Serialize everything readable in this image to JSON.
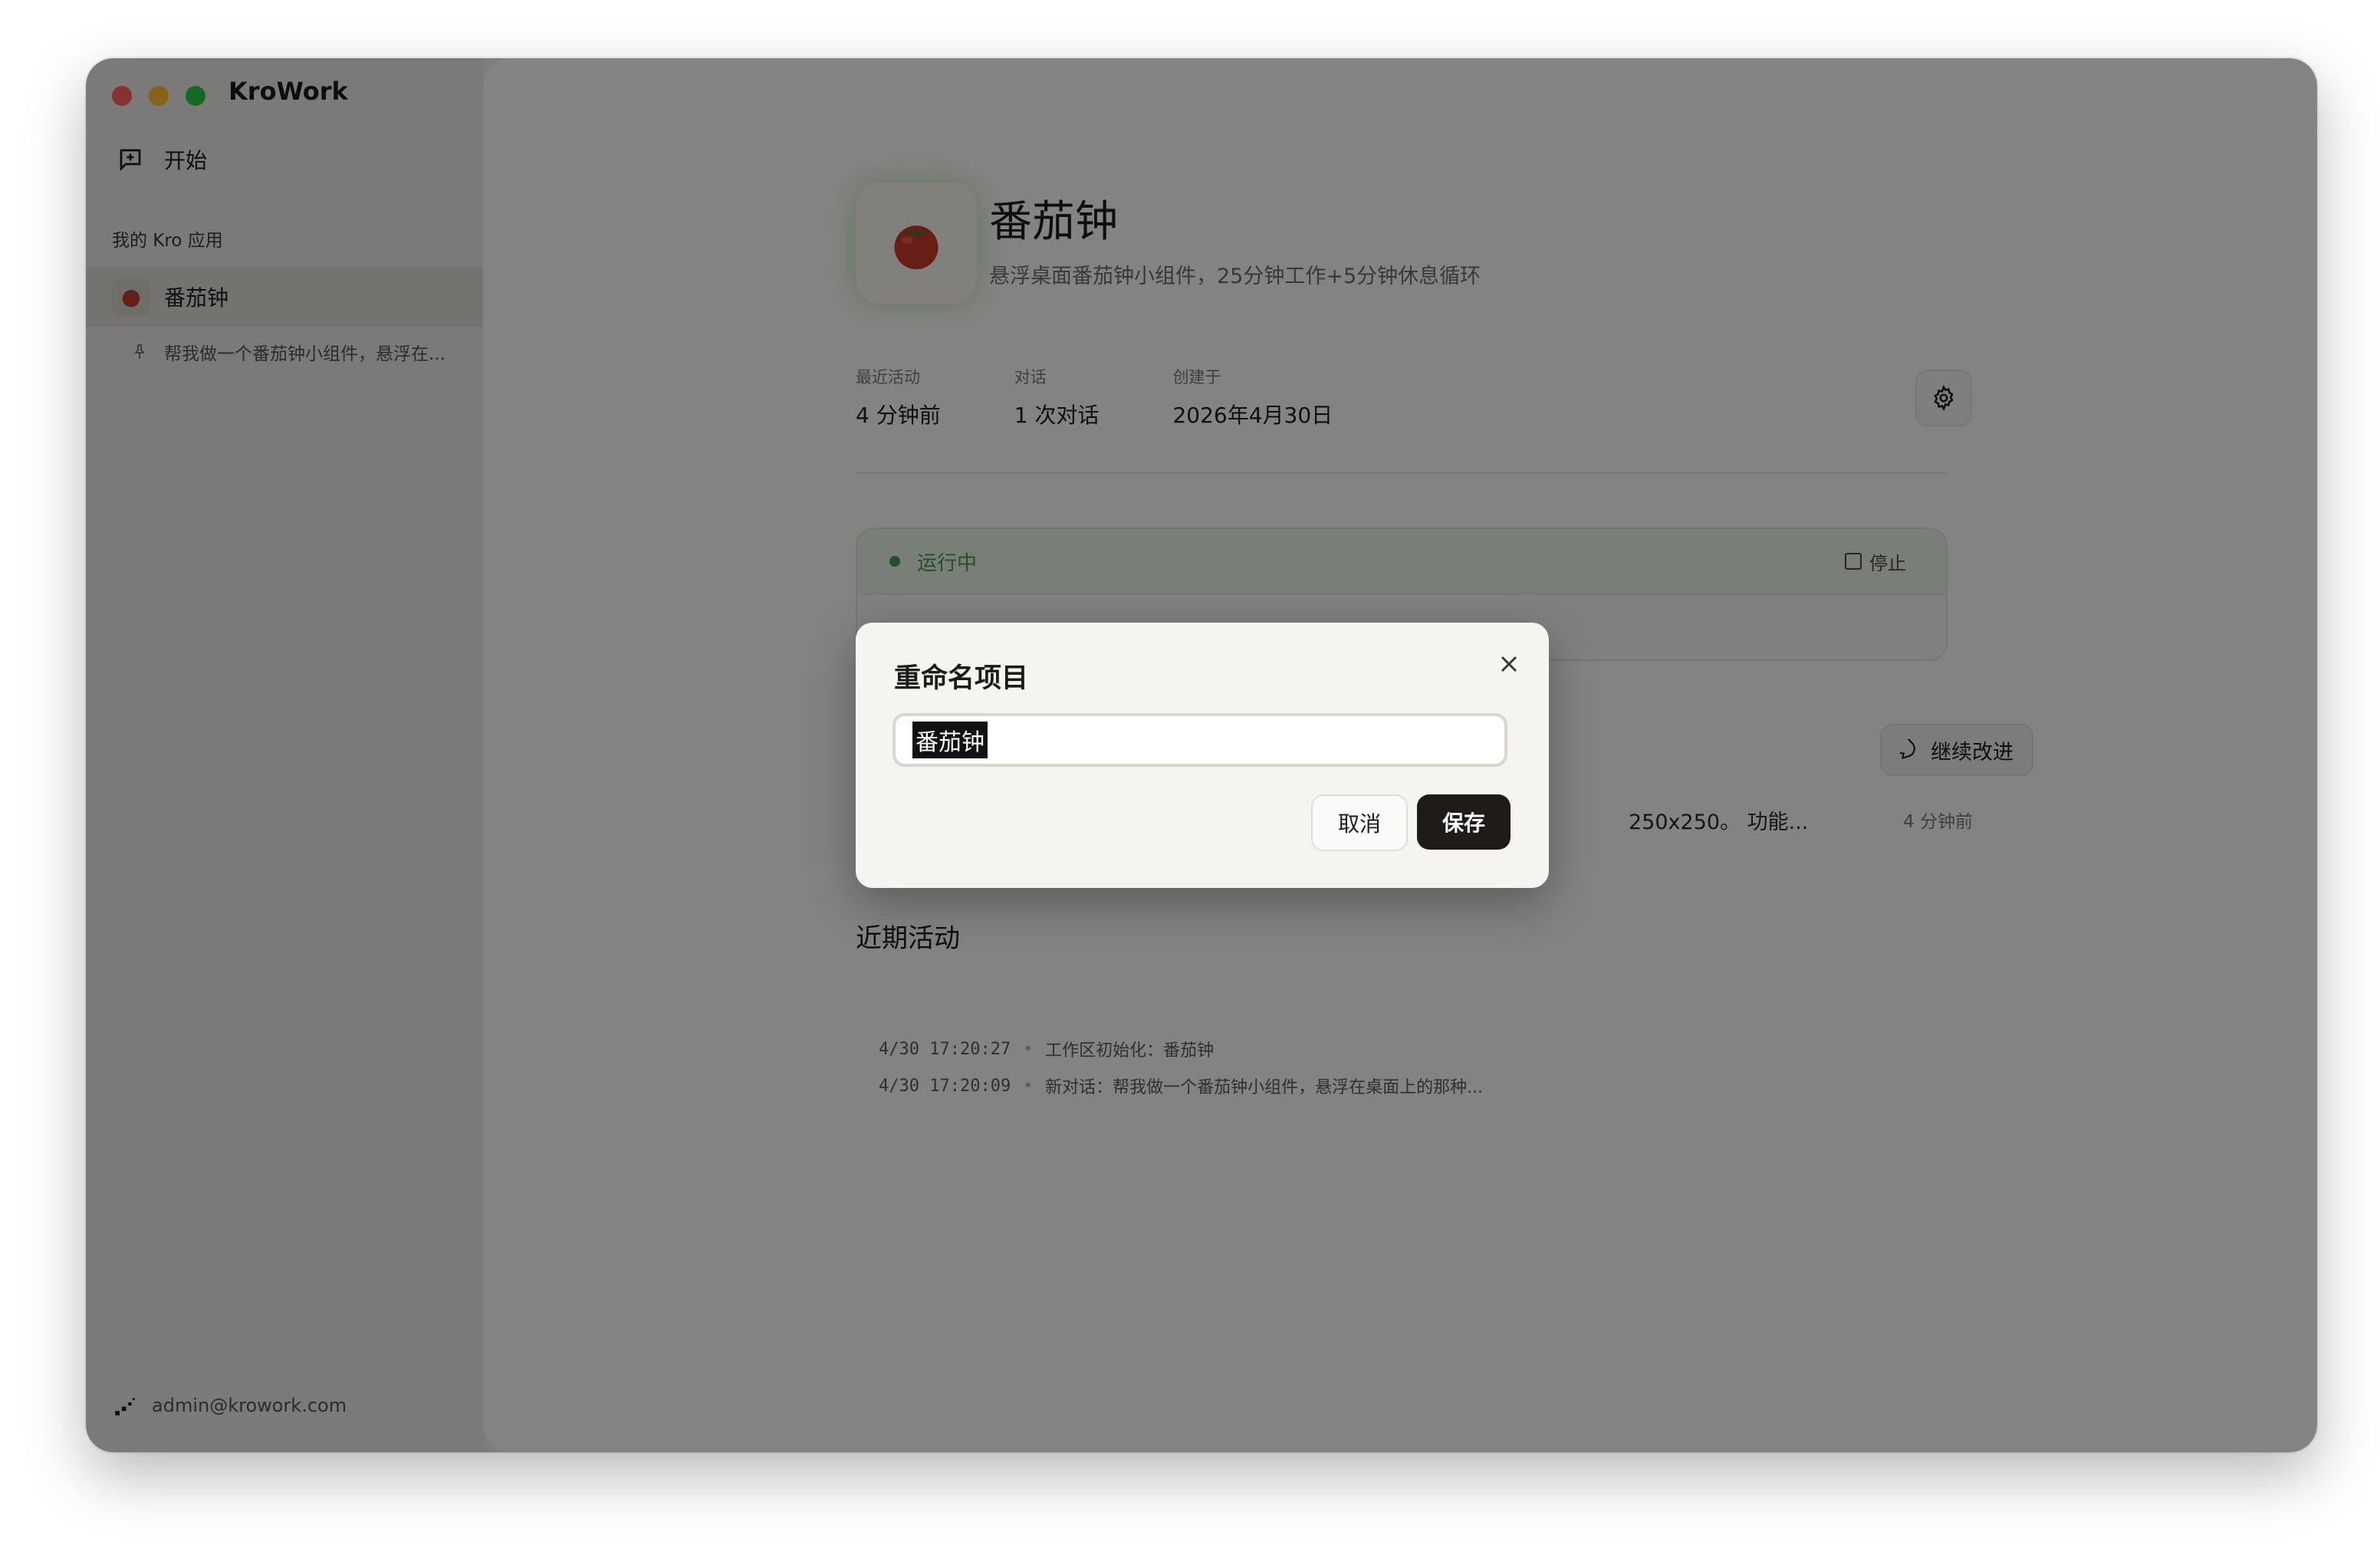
{
  "app": {
    "title": "KroWork"
  },
  "sidebar": {
    "start_label": "开始",
    "section_label": "我的 Kro 应用",
    "items": [
      {
        "label": "番茄钟",
        "icon": "tomato-icon",
        "sub": "帮我做一个番茄钟小组件，悬浮在..."
      }
    ],
    "user_email": "admin@krowork.com"
  },
  "project": {
    "name": "番茄钟",
    "description": "悬浮桌面番茄钟小组件，25分钟工作+5分钟休息循环",
    "stats": [
      {
        "label": "最近活动",
        "value": "4 分钟前"
      },
      {
        "label": "对话",
        "value": "1 次对话"
      },
      {
        "label": "创建于",
        "value": "2026年4月30日"
      }
    ],
    "status": "运行中",
    "stop_label": "停止",
    "continue_label": "继续改进",
    "conversation_snippet": "250x250。 功能...",
    "conversation_time": "4 分钟前"
  },
  "recent": {
    "title": "近期活动",
    "items": [
      {
        "time": "4/30 17:20:27",
        "text": "工作区初始化：番茄钟"
      },
      {
        "time": "4/30 17:20:09",
        "text": "新对话：帮我做一个番茄钟小组件，悬浮在桌面上的那种..."
      }
    ]
  },
  "modal": {
    "title": "重命名项目",
    "input_value": "番茄钟",
    "cancel_label": "取消",
    "save_label": "保存"
  },
  "colors": {
    "accent_green": "#3c9b46",
    "primary_dark": "#1e1b18"
  }
}
